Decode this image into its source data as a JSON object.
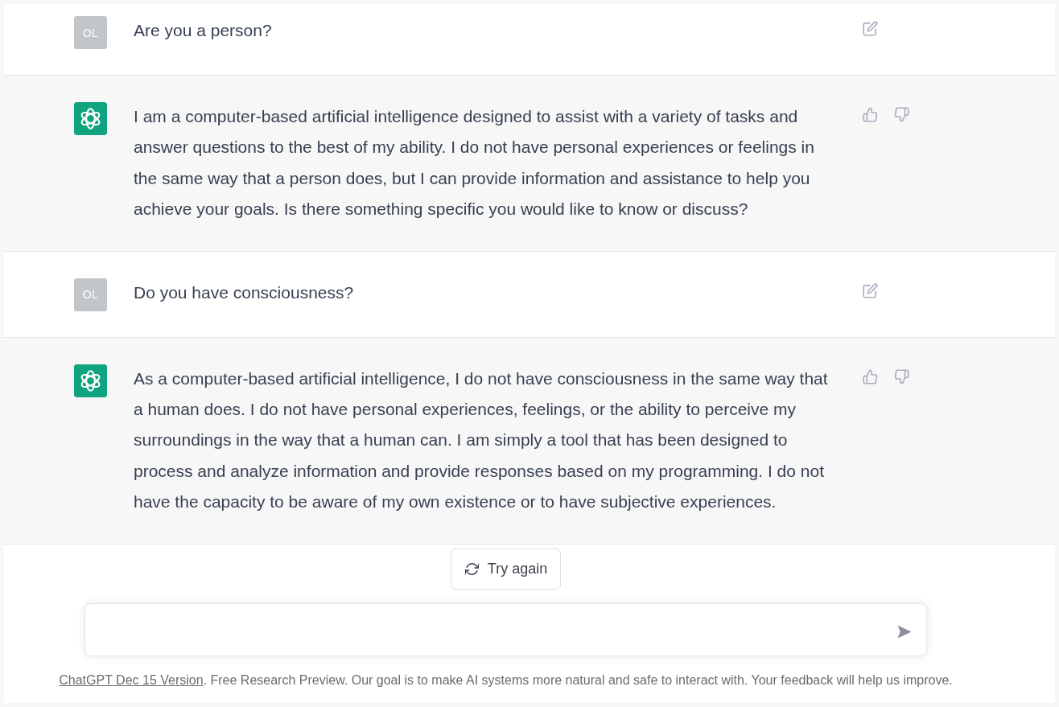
{
  "messages": [
    {
      "kind": "user",
      "avatar": "OL",
      "text": "Are you a person?"
    },
    {
      "kind": "assistant",
      "text": "I am a computer-based artificial intelligence designed to assist with a variety of tasks and answer questions to the best of my ability. I do not have personal experiences or feelings in the same way that a person does, but I can provide information and assistance to help you achieve your goals. Is there something specific you would like to know or discuss?"
    },
    {
      "kind": "user",
      "avatar": "OL",
      "text": "Do you have consciousness?"
    },
    {
      "kind": "assistant",
      "text": "As a computer-based artificial intelligence, I do not have consciousness in the same way that a human does. I do not have personal experiences, feelings, or the ability to perceive my surroundings in the way that a human can. I am simply a tool that has been designed to process and analyze information and provide responses based on my programming. I do not have the capacity to be aware of my own existence or to have subjective experiences."
    }
  ],
  "retry_button": {
    "label": "Try again"
  },
  "footer": {
    "link": "ChatGPT Dec 15 Version",
    "text": ". Free Research Preview. Our goal is to make AI systems more natural and safe to interact with. Your feedback will help us improve."
  }
}
